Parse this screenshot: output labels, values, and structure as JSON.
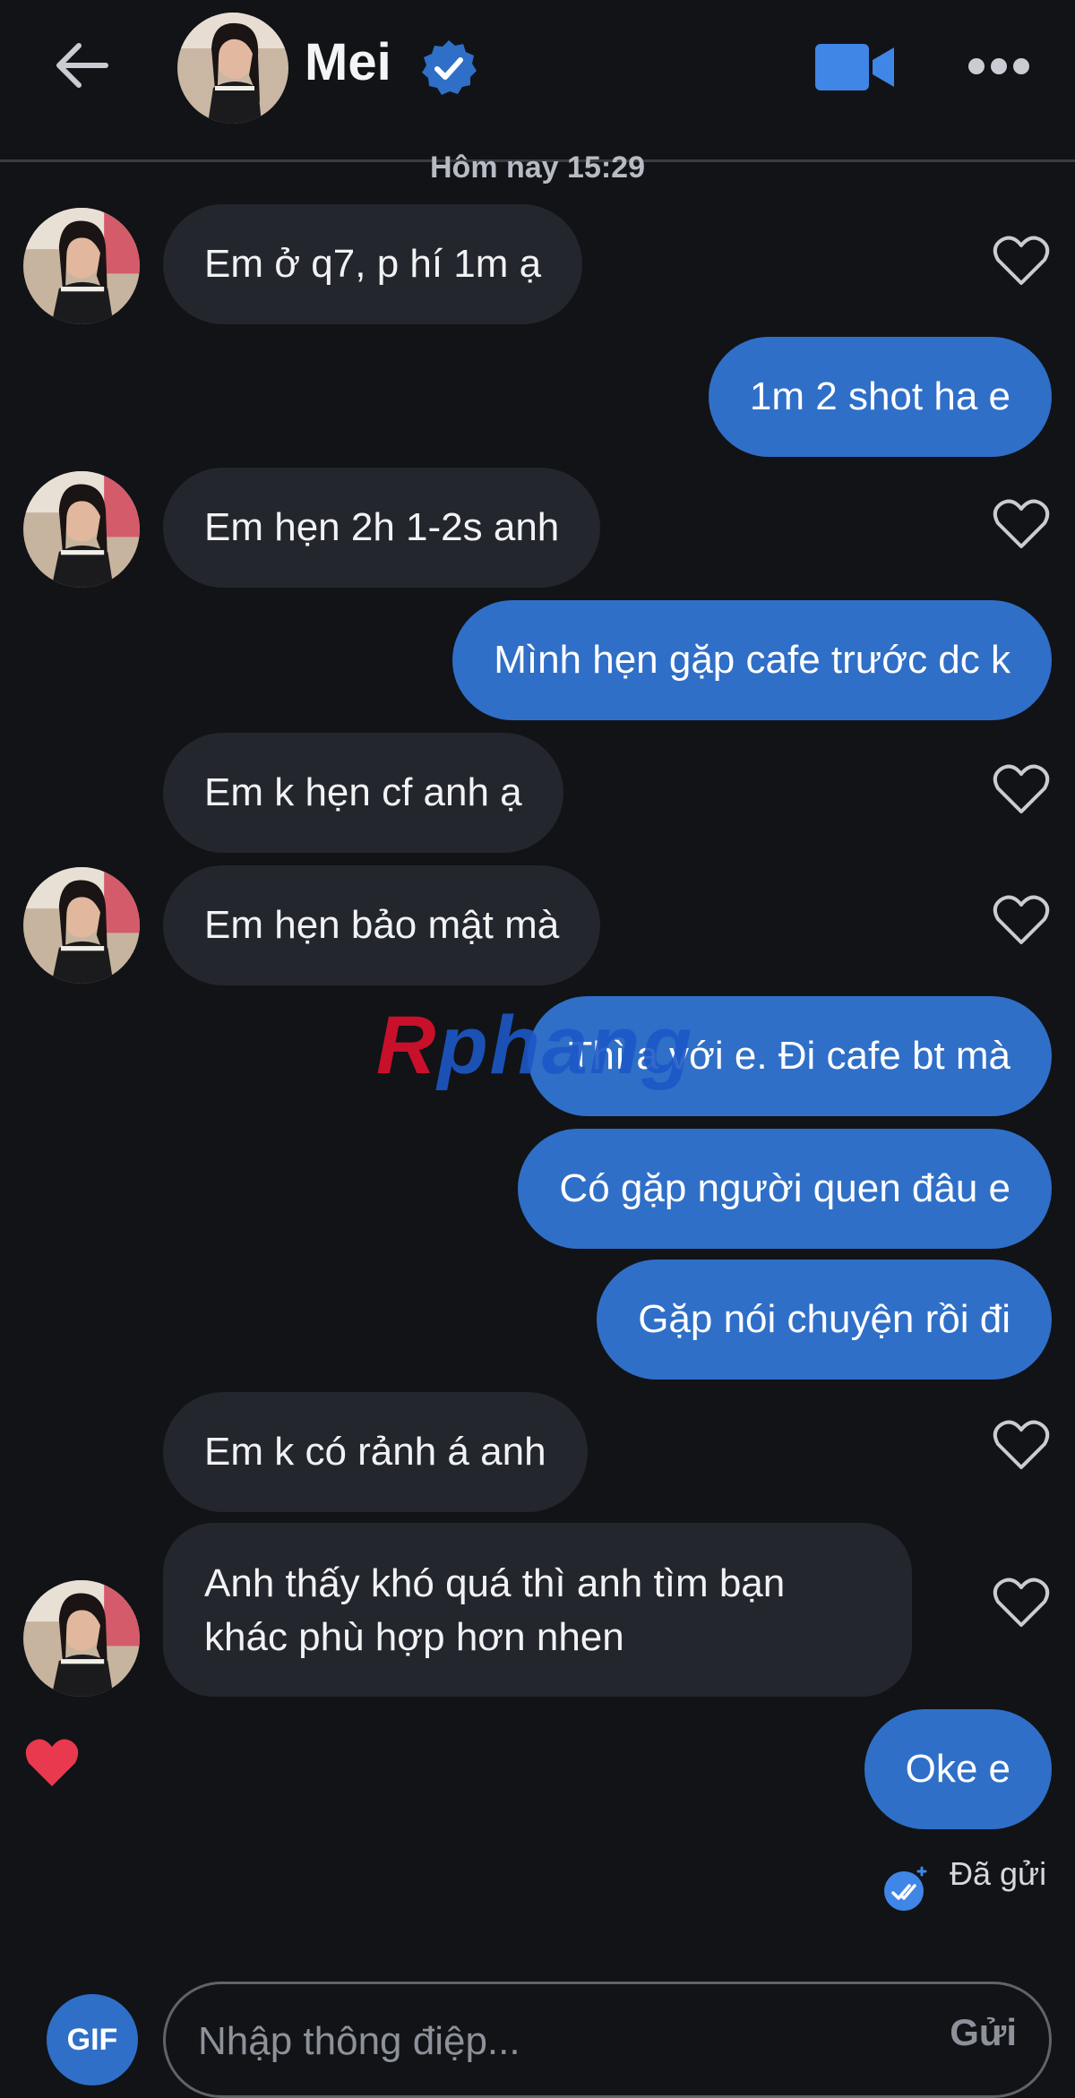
{
  "header": {
    "back_icon": "arrow-left-icon",
    "contact_name": "Mei",
    "verified_icon": "verified-badge-icon",
    "video_icon": "video-camera-icon",
    "more_icon": "more-horizontal-icon"
  },
  "timestamp": "Hôm nay 15:29",
  "messages": [
    {
      "dir": "in",
      "text": "Em ở q7, p hí 1m ạ"
    },
    {
      "dir": "out",
      "text": "1m 2 shot ha e"
    },
    {
      "dir": "in",
      "text": "Em hẹn 2h 1-2s anh"
    },
    {
      "dir": "out",
      "text": "Mình hẹn gặp cafe trước dc k"
    },
    {
      "dir": "in",
      "text": "Em k hẹn cf anh ạ"
    },
    {
      "dir": "in",
      "text": "Em hẹn bảo mật mà"
    },
    {
      "dir": "out",
      "text": "Thì a với e. Đi cafe bt mà"
    },
    {
      "dir": "out",
      "text": "Có gặp người quen đâu e"
    },
    {
      "dir": "out",
      "text": "Gặp nói chuyện rồi đi"
    },
    {
      "dir": "in",
      "text": "Em k có rảnh á anh"
    },
    {
      "dir": "in",
      "text": "Anh thấy khó quá thì anh tìm bạn khác phù hợp hơn nhen"
    },
    {
      "dir": "out",
      "text": "Oke e"
    }
  ],
  "status": {
    "label": "Đã gửi",
    "icon": "double-check-icon"
  },
  "composer": {
    "gif_label": "GIF",
    "placeholder": "Nhập thông điệp...",
    "send_label": "Gửi"
  },
  "watermark": {
    "r": "R",
    "rest": "phang"
  },
  "colors": {
    "background": "#111317",
    "incoming_bubble": "#23262d",
    "outgoing_bubble": "#2f6fc8",
    "like_red": "#e8394f"
  }
}
